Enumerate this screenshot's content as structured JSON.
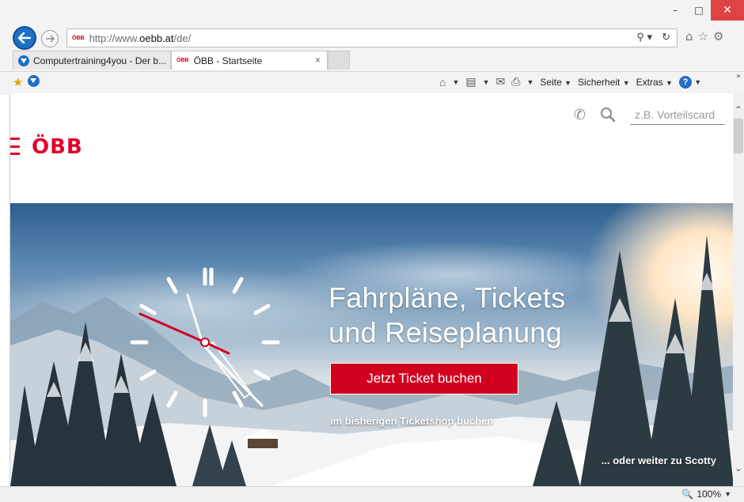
{
  "window": {
    "minimize": "–",
    "maximize": "□",
    "close": "✕"
  },
  "nav": {
    "back_icon": "back-arrow-icon",
    "forward_icon": "forward-arrow-icon",
    "address": {
      "favicon": "ÖBB",
      "url_prefix": "http://www.",
      "url_domain": "oebb.at",
      "url_suffix": "/de/"
    },
    "search_glyph": "⚲ ▾",
    "refresh_glyph": "↻"
  },
  "tabs": [
    {
      "label": "Computertraining4you - Der b...",
      "active": false
    },
    {
      "favicon": "ÖBB",
      "label": "ÖBB - Startseite",
      "active": true,
      "close": "×"
    }
  ],
  "commandbar": {
    "page_label": "Seite",
    "safety_label": "Sicherheit",
    "tools_label": "Extras",
    "help_label": "?"
  },
  "page": {
    "search_placeholder": "z.B. Vorteilscard",
    "logo_text": "ÖBB",
    "hero": {
      "title_line1": "Fahrpläne, Tickets",
      "title_line2": "und Reiseplanung",
      "cta_label": "Jetzt Ticket buchen",
      "legacy_link": "im bisherigen Ticketshop buchen",
      "scotty_link": "... oder weiter zu Scotty"
    }
  },
  "status": {
    "zoom": "100%"
  },
  "colors": {
    "brand_red": "#e2002a",
    "cta_red": "#d2001f",
    "ie_blue": "#1f6fc5"
  }
}
